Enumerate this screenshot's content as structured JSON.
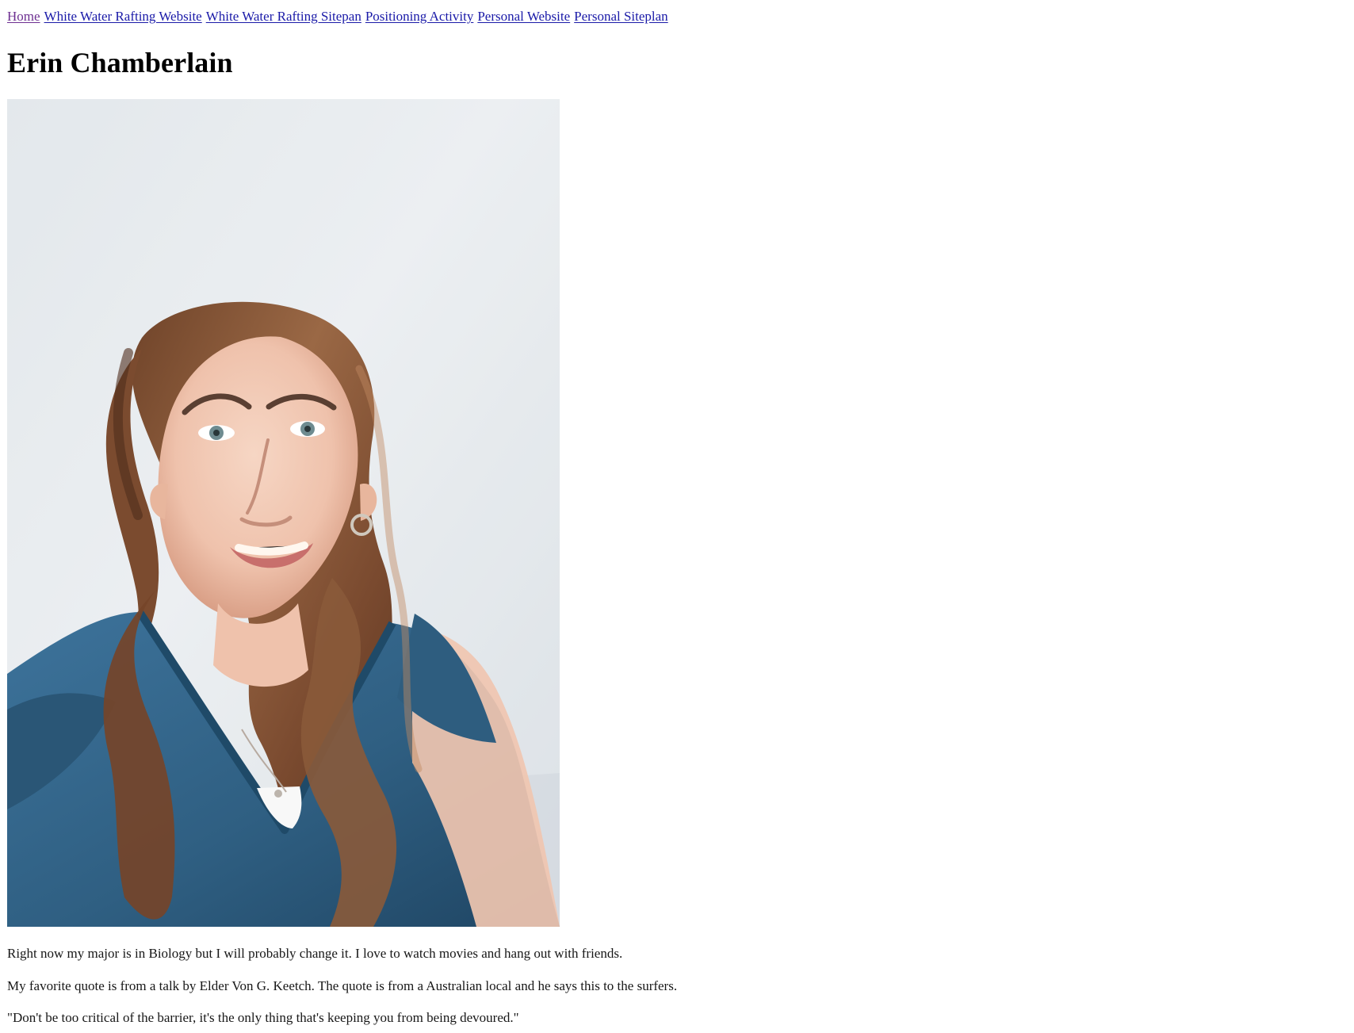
{
  "nav": {
    "links": [
      {
        "label": "Home",
        "state": "visited"
      },
      {
        "label": "White Water Rafting Website",
        "state": "unvisited"
      },
      {
        "label": "White Water Rafting Sitepan",
        "state": "unvisited"
      },
      {
        "label": "Positioning Activity",
        "state": "unvisited"
      },
      {
        "label": "Personal Website",
        "state": "unvisited"
      },
      {
        "label": "Personal Siteplan",
        "state": "unvisited"
      }
    ]
  },
  "profile": {
    "name": "Erin Chamberlain",
    "photo_icon": "portrait-photo-icon"
  },
  "bio": {
    "paragraphs": [
      "Right now my major is in Biology but I will probably change it. I love to watch movies and hang out with friends.",
      "My favorite quote is from a talk by Elder Von G. Keetch. The quote is from a Australian local and he says this to the surfers.",
      "\"Don't be too critical of the barrier, it's the only thing that's keeping you from being devoured.\""
    ]
  },
  "colors": {
    "page_background": "#ffffff",
    "link_visited": "#6d2f91",
    "link_unvisited": "#1a1aa8",
    "text": "#171717",
    "photo_background": "#dce2e8",
    "shirt": "#2f5f82",
    "hair": "#8a5a3a",
    "skin": "#f0c8b2"
  }
}
